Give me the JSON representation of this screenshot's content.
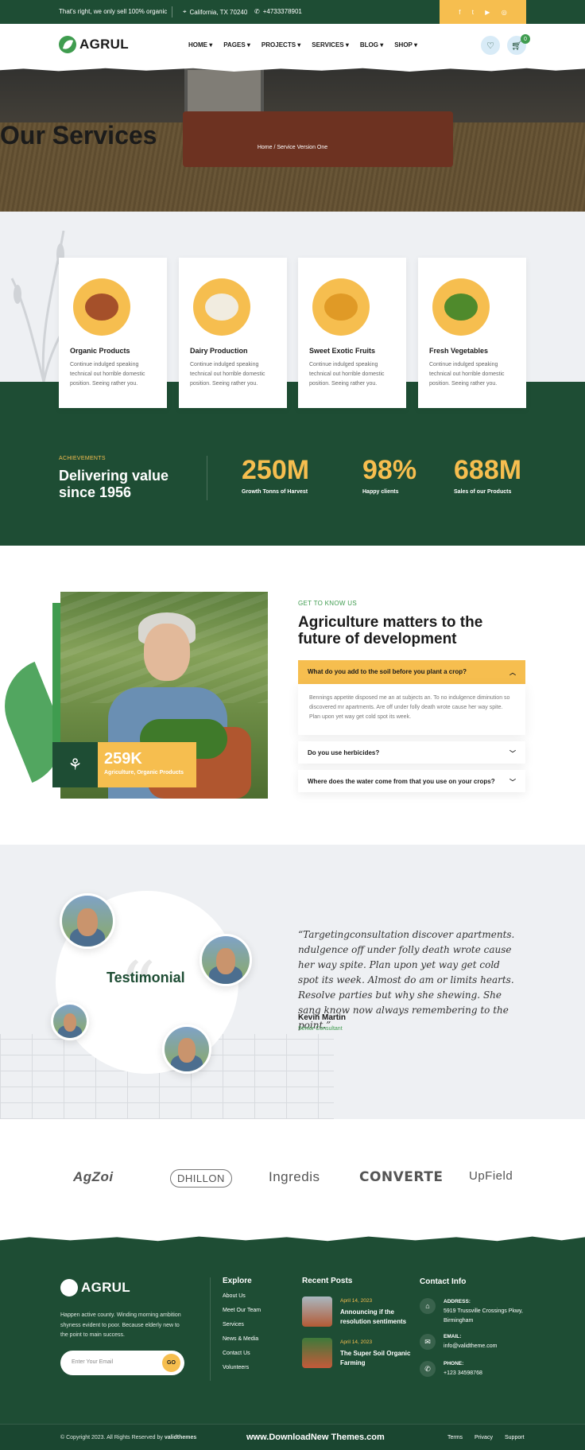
{
  "topbar": {
    "message": "That's right, we only sell 100% organic",
    "location": "California, TX 70240",
    "phone": "+4733378901",
    "social_icons": [
      "facebook-icon",
      "twitter-icon",
      "youtube-icon",
      "instagram-icon"
    ],
    "social_glyphs": [
      "f",
      "t",
      "▶",
      "◎"
    ]
  },
  "brand": {
    "name": "AGRUL"
  },
  "nav": [
    {
      "label": "HOME"
    },
    {
      "label": "PAGES"
    },
    {
      "label": "PROJECTS"
    },
    {
      "label": "SERVICES"
    },
    {
      "label": "BLOG"
    },
    {
      "label": "SHOP"
    }
  ],
  "header": {
    "cart_count": "0"
  },
  "hero": {
    "title": "Our Services",
    "breadcrumb": "Home / Service Version One"
  },
  "services": [
    {
      "title": "Organic Products",
      "text": "Continue indulged speaking technical out horrible domestic position. Seeing rather you."
    },
    {
      "title": "Dairy Production",
      "text": "Continue indulged speaking technical out horrible domestic position. Seeing rather you."
    },
    {
      "title": "Sweet Exotic Fruits",
      "text": "Continue indulged speaking technical out horrible domestic position. Seeing rather you."
    },
    {
      "title": "Fresh Vegetables",
      "text": "Continue indulged speaking technical out horrible domestic position. Seeing rather you."
    }
  ],
  "achievements": {
    "label": "ACHIEVEMENTS",
    "title": "Delivering value since 1956",
    "stats": [
      {
        "value": "250M",
        "label": "Growth Tonns of Harvest"
      },
      {
        "value": "98%",
        "label": "Happy clients"
      },
      {
        "value": "688M",
        "label": "Sales of our Products"
      }
    ]
  },
  "about": {
    "eyebrow": "GET TO KNOW US",
    "title": "Agriculture matters to the future of development",
    "stat_value": "259K",
    "stat_label": "Agriculture, Organic Products",
    "faq": [
      {
        "q": "What do you add to the soil before you plant a crop?",
        "a": "Bennings appetite disposed me an at subjects an. To no indulgence diminution so discovered mr apartments. Are off under folly death wrote cause her way spite. Plan upon yet way get cold spot its week.",
        "open": true
      },
      {
        "q": "Do you use herbicides?",
        "open": false
      },
      {
        "q": "Where does the water come from that you use on your crops?",
        "open": false
      }
    ]
  },
  "testimonial": {
    "heading": "Testimonial",
    "quote": "“Targetingconsultation discover apartments. ndulgence off under folly death wrote cause her way spite. Plan upon yet way get cold spot its week. Almost do am or limits hearts. Resolve parties but why she shewing. She sang know now always remembering to the point.”",
    "name": "Kevin Martin",
    "role": "Senior Consultant"
  },
  "brands": [
    "AgZoi",
    "DHILLON",
    "Ingredis",
    "CONVERTE",
    "UpField"
  ],
  "footer": {
    "about": "Happen active county. Winding morning ambition shyness evident to poor. Because elderly new to the point to main success.",
    "email_placeholder": "Enter Your Email",
    "go_label": "GO",
    "explore_heading": "Explore",
    "explore_links": [
      "About Us",
      "Meet Our Team",
      "Services",
      "News & Media",
      "Contact Us",
      "Volunteers"
    ],
    "posts_heading": "Recent Posts",
    "posts": [
      {
        "date": "April 14, 2023",
        "title": "Announcing if the resolution sentiments"
      },
      {
        "date": "April 14, 2023",
        "title": "The Super Soil Organic Farming"
      }
    ],
    "contact_heading": "Contact Info",
    "contact": [
      {
        "label": "ADDRESS:",
        "value": "5919 Trussville Crossings Pkwy, Birmingham"
      },
      {
        "label": "EMAIL:",
        "value": "info@validtheme.com"
      },
      {
        "label": "PHONE:",
        "value": "+123 34598768"
      }
    ],
    "copyright_prefix": "© Copyright 2023. All Rights Reserved by",
    "copyright_owner": "validthemes",
    "watermark": "www.DownloadNew Themes.com",
    "bottom_links": [
      "Terms",
      "Privacy",
      "Support"
    ]
  }
}
